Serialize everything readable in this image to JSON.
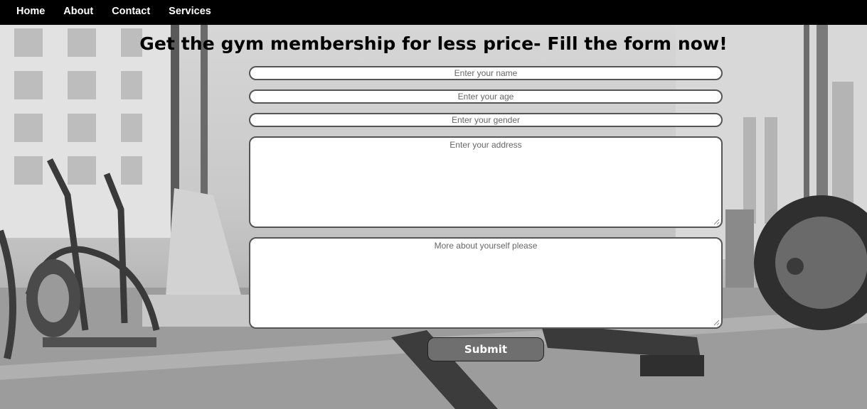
{
  "nav": {
    "items": [
      {
        "label": "Home"
      },
      {
        "label": "About"
      },
      {
        "label": "Contact"
      },
      {
        "label": "Services"
      }
    ]
  },
  "page": {
    "heading": "Get the gym membership for less price- Fill the form now!"
  },
  "form": {
    "name_placeholder": "Enter your name",
    "age_placeholder": "Enter your age",
    "gender_placeholder": "Enter your gender",
    "address_placeholder": "Enter your address",
    "about_placeholder": "More about yourself please",
    "submit_label": "Submit"
  },
  "colors": {
    "navbar_bg": "#000000",
    "submit_bg": "#6f6f6f",
    "field_border": "#555555"
  }
}
